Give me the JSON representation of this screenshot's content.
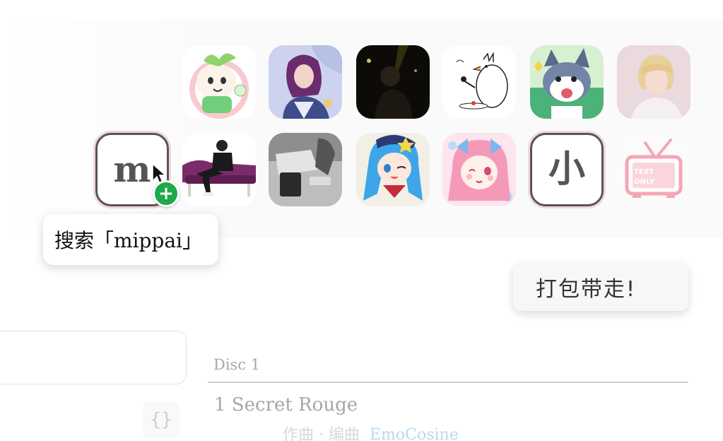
{
  "tooltip": {
    "text": "搜索「mippai」"
  },
  "pack_button": {
    "label": "打包带走!"
  },
  "letter_tiles": {
    "m_glyph": "m",
    "xiao_glyph": "小"
  },
  "plus_badge": {
    "glyph": "+"
  },
  "braces_glyph": "{}",
  "disc": {
    "label": "Disc 1",
    "tracks": [
      {
        "title": "1 Secret Rouge",
        "credit_roles": "作曲 · 编曲",
        "credit_name": "EmoCosine"
      }
    ]
  },
  "colors": {
    "accent_green": "#20a84a",
    "tile_border": "#555555",
    "tile_glow": "#f4d6dc",
    "credit_link": "#b9d9ee"
  },
  "icons": {
    "add": "plus-icon",
    "cursor": "mouse-pointer-icon",
    "braces": "code-braces-icon"
  }
}
